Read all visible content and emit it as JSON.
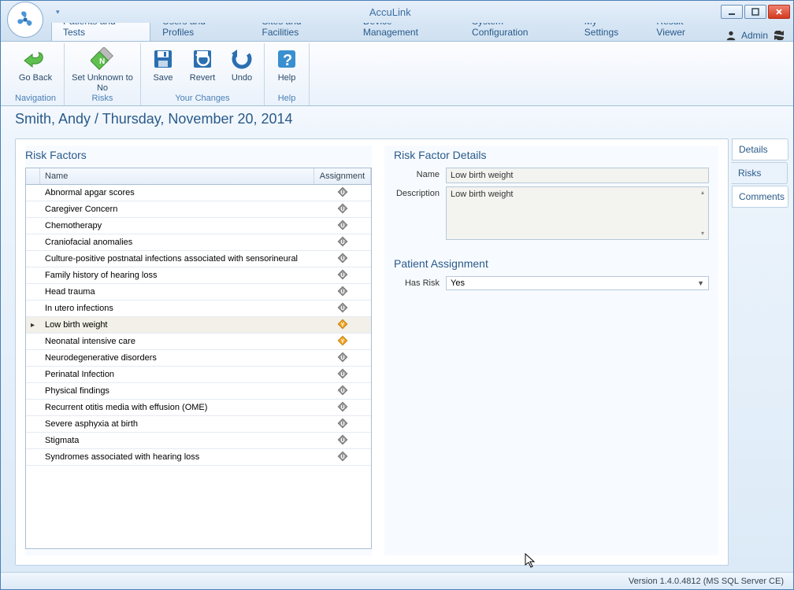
{
  "app_title": "AccuLink",
  "user_label": "Admin",
  "tabs": {
    "patients": "Patients and Tests",
    "users": "Users and Profiles",
    "sites": "Sites and Facilities",
    "device": "Device Management",
    "syscfg": "System Configuration",
    "mysettings": "My Settings",
    "resultviewer": "Result Viewer"
  },
  "ribbon": {
    "go_back": "Go Back",
    "set_unknown": "Set Unknown to No",
    "save": "Save",
    "revert": "Revert",
    "undo": "Undo",
    "help": "Help",
    "group_nav": "Navigation",
    "group_risks": "Risks",
    "group_changes": "Your Changes",
    "group_help": "Help"
  },
  "breadcrumb": "Smith, Andy / Thursday, November 20, 2014",
  "left": {
    "title": "Risk Factors",
    "col_name": "Name",
    "col_assignment": "Assignment",
    "rows": [
      {
        "name": "Abnormal apgar scores",
        "assign": "U"
      },
      {
        "name": "Caregiver Concern",
        "assign": "U"
      },
      {
        "name": "Chemotherapy",
        "assign": "U"
      },
      {
        "name": "Craniofacial anomalies",
        "assign": "U"
      },
      {
        "name": "Culture-positive postnatal infections associated with sensorineural",
        "assign": "U"
      },
      {
        "name": "Family history of hearing loss",
        "assign": "U"
      },
      {
        "name": "Head trauma",
        "assign": "U"
      },
      {
        "name": "In utero infections",
        "assign": "U"
      },
      {
        "name": "Low birth weight",
        "assign": "Y"
      },
      {
        "name": "Neonatal intensive care",
        "assign": "Y"
      },
      {
        "name": "Neurodegenerative disorders",
        "assign": "U"
      },
      {
        "name": "Perinatal Infection",
        "assign": "U"
      },
      {
        "name": "Physical findings",
        "assign": "U"
      },
      {
        "name": "Recurrent otitis media with effusion (OME)",
        "assign": "U"
      },
      {
        "name": "Severe asphyxia at birth",
        "assign": "U"
      },
      {
        "name": "Stigmata",
        "assign": "U"
      },
      {
        "name": "Syndromes associated with hearing loss",
        "assign": "U"
      }
    ],
    "selected_index": 8
  },
  "right": {
    "title_details": "Risk Factor Details",
    "label_name": "Name",
    "value_name": "Low birth weight",
    "label_description": "Description",
    "value_description": "Low birth weight",
    "title_assignment": "Patient Assignment",
    "label_hasrisk": "Has Risk",
    "value_hasrisk": "Yes"
  },
  "side_tabs": {
    "details": "Details",
    "risks": "Risks",
    "comments": "Comments"
  },
  "statusbar": "Version 1.4.0.4812 (MS SQL Server CE)"
}
